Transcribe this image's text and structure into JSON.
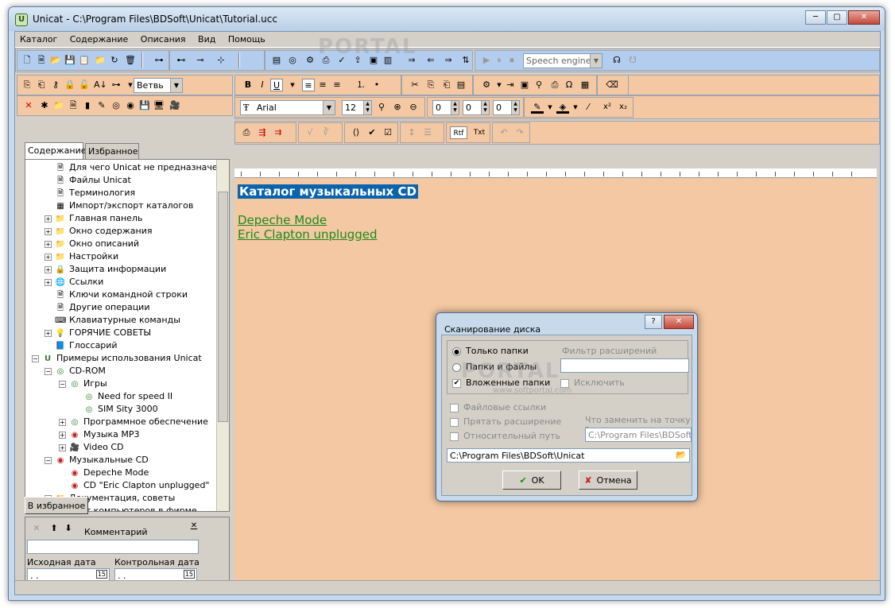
{
  "window": {
    "title": "Unicat - C:\\Program Files\\BDSoft\\Unicat\\Tutorial.ucc",
    "icon": "unicat-app-icon"
  },
  "caption_buttons": {
    "minimize": "─",
    "maximize": "▢",
    "close": "✕"
  },
  "menu": [
    "Каталог",
    "Содержание",
    "Описания",
    "Вид",
    "Помощь"
  ],
  "toolbar_main": {
    "speech_combo": "Speech engines"
  },
  "toolbar_left": {
    "branch_combo": "Ветвь"
  },
  "toolbar_format": {
    "bold": "B",
    "italic": "I",
    "underline": "U"
  },
  "toolbar_font": {
    "font": "Arial",
    "size": "12",
    "spin1": "0",
    "spin2": "0",
    "spin3": "0",
    "superscript": "x²",
    "subscript": "x₂"
  },
  "toolbar_misc": {
    "rtf": "Rtf",
    "txt": "Txt"
  },
  "left_tabs": [
    "Содержание",
    "Избранное"
  ],
  "tree": [
    {
      "label": "Для чего Unicat не предназначен",
      "level": 2,
      "icon": "doc"
    },
    {
      "label": "Файлы Unicat",
      "level": 2,
      "icon": "doc"
    },
    {
      "label": "Терминология",
      "level": 2,
      "icon": "doc"
    },
    {
      "label": "Импорт/экспорт каталогов",
      "level": 2,
      "icon": "grid"
    },
    {
      "label": "Главная панель",
      "level": 2,
      "icon": "folder",
      "exp": "+"
    },
    {
      "label": "Окно содержания",
      "level": 2,
      "icon": "folder",
      "exp": "+"
    },
    {
      "label": "Окно описаний",
      "level": 2,
      "icon": "folder",
      "exp": "+"
    },
    {
      "label": "Настройки",
      "level": 2,
      "icon": "folder",
      "exp": "+"
    },
    {
      "label": "Защита информации",
      "level": 2,
      "icon": "lock",
      "exp": "+"
    },
    {
      "label": "Ссылки",
      "level": 2,
      "icon": "globe",
      "exp": "+"
    },
    {
      "label": "Ключи командной строки",
      "level": 2,
      "icon": "doc"
    },
    {
      "label": "Другие операции",
      "level": 2,
      "icon": "doc"
    },
    {
      "label": "Клавиатурные команды",
      "level": 2,
      "icon": "keyboard"
    },
    {
      "label": "ГОРЯЧИЕ СОВЕТЫ",
      "level": 2,
      "icon": "bulb",
      "exp": "+"
    },
    {
      "label": "Глоссарий",
      "level": 2,
      "icon": "book"
    },
    {
      "label": "Примеры использования Unicat",
      "level": 1,
      "icon": "unicat",
      "exp": "−"
    },
    {
      "label": "CD-ROM",
      "level": 2,
      "icon": "cd",
      "exp": "−"
    },
    {
      "label": "Игры",
      "level": 3,
      "icon": "cd",
      "exp": "−"
    },
    {
      "label": "Need for speed II",
      "level": 4,
      "icon": "cd"
    },
    {
      "label": "SIM Sity 3000",
      "level": 4,
      "icon": "cd"
    },
    {
      "label": "Программное обеспечение",
      "level": 3,
      "icon": "cd",
      "exp": "+"
    },
    {
      "label": "Музыка MP3",
      "level": 3,
      "icon": "cd-red",
      "exp": "+"
    },
    {
      "label": "Video CD",
      "level": 3,
      "icon": "camera",
      "exp": "+"
    },
    {
      "label": "Музыкальные CD",
      "level": 2,
      "icon": "cd-red",
      "exp": "−"
    },
    {
      "label": "Depeche Mode",
      "level": 3,
      "icon": "cd-red"
    },
    {
      "label": "CD \"Eric Clapton unplugged\"",
      "level": 3,
      "icon": "cd-red"
    },
    {
      "label": "Документация, советы",
      "level": 2,
      "icon": "folder",
      "exp": "+"
    },
    {
      "label": "Чист компьютеров в фирме",
      "level": 2,
      "icon": "pc",
      "exp": "+"
    }
  ],
  "left_bottom": {
    "add_favorites": "В избранное",
    "comment_label": "Комментарий",
    "comment_value": "",
    "start_date_label": "Исходная дата",
    "control_date_label": "Контрольная дата",
    "start_date": " . .",
    "control_date": " . .",
    "calendar_glyph": "15"
  },
  "editor": {
    "heading": "Каталог музыкальных CD",
    "links": [
      "Depeche Mode",
      "Eric Clapton unplugged"
    ]
  },
  "dialog": {
    "title": "Сканирование диска",
    "help": "?",
    "close": "✕",
    "opt_folders_only": "Только папки",
    "opt_folders_files": "Папки и файлы",
    "chk_nested": "Вложенные папки",
    "filter_label": "Фильтр расширений",
    "filter_value": "",
    "chk_exclude": "Исключить",
    "chk_file_links": "Файловые ссылки",
    "chk_hide_ext": "Прятать расширение",
    "chk_relative": "Относительный путь",
    "replace_label": "Что заменить на точку ?",
    "replace_value": "C:\\Program Files\\BDSoft\\U",
    "path_value": "C:\\Program Files\\BDSoft\\Unicat",
    "ok": "OK",
    "cancel": "Отмена"
  },
  "colors": {
    "accent_blue": "#b3cdef",
    "peach": "#f4c8a2",
    "heading_bg": "#0a64ad",
    "link": "#1b8a1b"
  },
  "watermark": {
    "text1": "PORTAL",
    "text2": "www.softportal.com"
  }
}
